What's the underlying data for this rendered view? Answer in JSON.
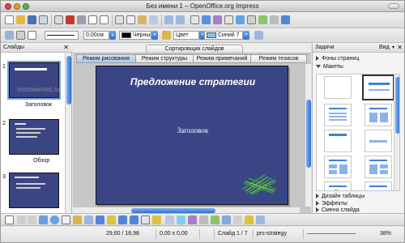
{
  "window": {
    "title": "Без имени 1 – OpenOffice.org Impress"
  },
  "toolbar2": {
    "line_width": "0,00см",
    "line_color": "Черный",
    "area_style": "Цвет",
    "area_color": "Синий 7"
  },
  "slides_pane": {
    "title": "Слайды",
    "watermark": "mostwanted.ru",
    "thumbs": [
      {
        "num": "1",
        "label": "Заголовок"
      },
      {
        "num": "2",
        "label": "Обзор"
      },
      {
        "num": "3",
        "label": ""
      }
    ]
  },
  "center": {
    "sorter_tab": "Сортировщик слайдов",
    "mode_tabs": [
      "Режим рисования",
      "Режим структуры",
      "Режим примечаний",
      "Режим тезисов"
    ],
    "slide_title": "Предложение стратегии",
    "slide_subtitle": "Заголовок"
  },
  "tasks": {
    "title": "Задачи",
    "view_label": "Вид",
    "sections_top": [
      {
        "label": "Фоны страниц",
        "expanded": false
      },
      {
        "label": "Макеты",
        "expanded": true
      }
    ],
    "sections_bottom": [
      {
        "label": "Дизайн таблицы",
        "expanded": false
      },
      {
        "label": "Эффекты",
        "expanded": false
      },
      {
        "label": "Смена слайда",
        "expanded": false
      }
    ]
  },
  "status": {
    "position": "29,60 / 18,98",
    "size": "0,00 x 0,00",
    "slide": "Слайд 1 / 7",
    "template": "prs-strategy",
    "zoom": "38%"
  },
  "colors": {
    "slide_bg": "#3a4586",
    "accent": "#2f6fd2"
  }
}
